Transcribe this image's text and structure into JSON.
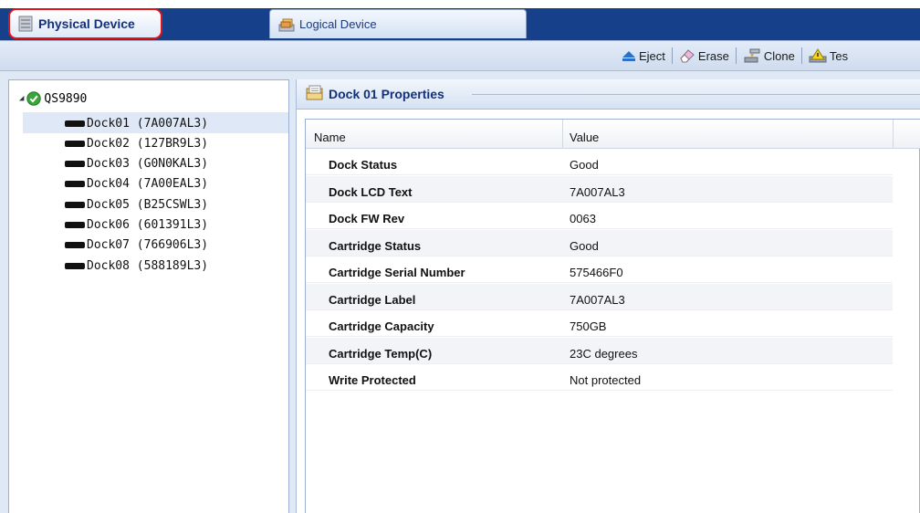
{
  "tabs": {
    "physical_label": "Physical Device",
    "logical_label": "Logical Device"
  },
  "toolbar": {
    "eject_label": "Eject",
    "erase_label": "Erase",
    "clone_label": "Clone",
    "test_label": "Tes"
  },
  "tree": {
    "root_label": "QS9890",
    "docks": [
      "Dock01 (7A007AL3)",
      "Dock02 (127BR9L3)",
      "Dock03 (G0N0KAL3)",
      "Dock04 (7A00EAL3)",
      "Dock05 (B25CSWL3)",
      "Dock06 (601391L3)",
      "Dock07 (766906L3)",
      "Dock08 (588189L3)"
    ],
    "selected_index": 0
  },
  "properties": {
    "title": "Dock 01 Properties",
    "col_name": "Name",
    "col_value": "Value",
    "rows": [
      {
        "name": "Dock Status",
        "value": "Good"
      },
      {
        "name": "Dock LCD Text",
        "value": "7A007AL3"
      },
      {
        "name": "Dock FW Rev",
        "value": "0063"
      },
      {
        "name": "Cartridge Status",
        "value": "Good"
      },
      {
        "name": "Cartridge Serial Number",
        "value": "575466F0"
      },
      {
        "name": "Cartridge Label",
        "value": "7A007AL3"
      },
      {
        "name": "Cartridge Capacity",
        "value": "750GB"
      },
      {
        "name": "Cartridge Temp(C)",
        "value": "23C degrees"
      },
      {
        "name": "Write Protected",
        "value": "Not protected"
      }
    ]
  },
  "colors": {
    "tab_bar": "#16418a",
    "highlight_ring": "#e0151a",
    "status_ok": "#3aa53a"
  }
}
